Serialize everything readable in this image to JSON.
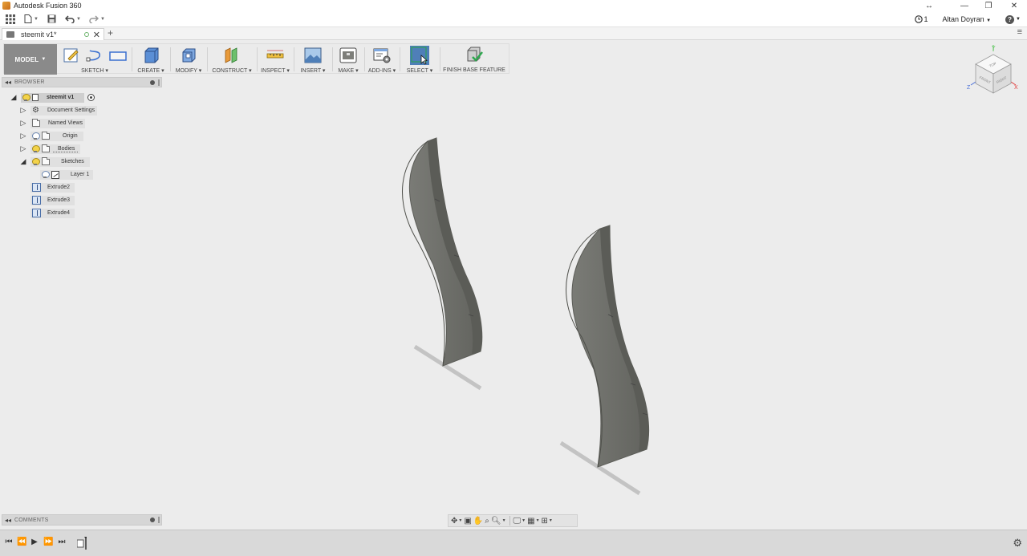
{
  "window": {
    "title": "Autodesk Fusion 360",
    "controls": {
      "resize": "↔",
      "minimize": "—",
      "maximize": "❐",
      "close": "✕"
    }
  },
  "quick_access": {
    "job_status_count": "1",
    "user_name": "Altan Doyran",
    "help_icon": "?"
  },
  "document_tab": {
    "name": "steemit v1*",
    "close": "✕"
  },
  "toolbar": {
    "workspace": "MODEL",
    "groups": {
      "sketch": "SKETCH ▾",
      "create": "CREATE ▾",
      "modify": "MODIFY ▾",
      "construct": "CONSTRUCT ▾",
      "inspect": "INSPECT ▾",
      "insert": "INSERT ▾",
      "make": "MAKE ▾",
      "addins": "ADD-INS ▾",
      "select": "SELECT ▾",
      "finish": "FINISH BASE FEATURE"
    }
  },
  "browser": {
    "title": "BROWSER",
    "items": [
      {
        "label": "steemit v1"
      },
      {
        "label": "Document Settings"
      },
      {
        "label": "Named Views"
      },
      {
        "label": "Origin"
      },
      {
        "label": "Bodies"
      },
      {
        "label": "Sketches"
      },
      {
        "label": "Layer 1"
      },
      {
        "label": "Extrude2"
      },
      {
        "label": "Extrude3"
      },
      {
        "label": "Extrude4"
      }
    ]
  },
  "comments": {
    "title": "COMMENTS"
  },
  "viewcube": {
    "top": "TOP",
    "front": "FRONT",
    "right": "RIGHT",
    "x": "X",
    "y": "Y",
    "z": "Z"
  },
  "colors": {
    "body_fill": "#7d7e79",
    "body_edge": "#5f605b",
    "sketch_line": "#c4c4c4",
    "axis_x": "#e23b3b",
    "axis_y": "#5cc65c",
    "axis_z": "#4a6fd8",
    "select_active": "#4f7fb8"
  }
}
